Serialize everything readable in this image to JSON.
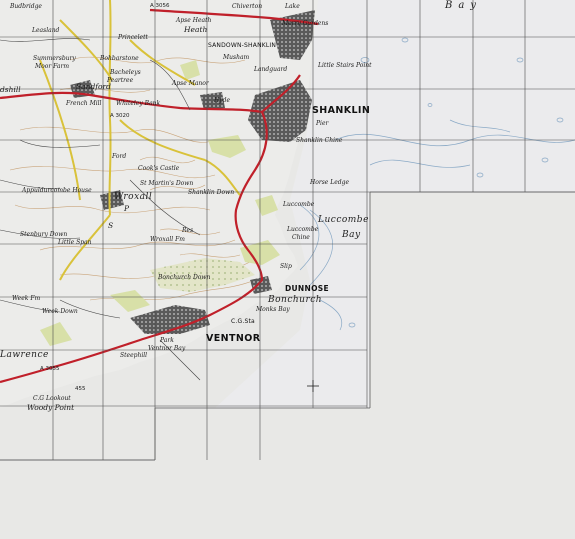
{
  "colors": {
    "background": "#e8e8e6",
    "land": "#ececea",
    "sea": "#e9eaec",
    "grid": "#4a4a4a",
    "main_road": "#c0202a",
    "secondary_road": "#d9c23a",
    "woodland": "#d8e0a8",
    "town": "#5a5a5a",
    "contour": "#c9a47a",
    "water_pattern": "#8aa9c6",
    "text": "#1a1a1a"
  },
  "labels": {
    "bay_top": "Bay",
    "shanklin": "SHANKLIN",
    "ventnor": "VENTNOR",
    "dunnose": "DUNNOSE",
    "bonchurch": "Bonchurch",
    "luccombe_bay_1": "Luccombe",
    "luccombe_bay_2": "Bay",
    "luccombe": "Luccombe",
    "luccombe_chine_1": "Luccombe",
    "luccombe_chine_2": "Chine",
    "horse_ledge": "Horse Ledge",
    "shanklin_chine": "Shanklin Chine",
    "little_stairs_point": "Little Stairs Point",
    "merry_gardens": "Merry Gardens",
    "sandown_shanklin": "SANDOWN-SHANKLIN",
    "landguard": "Landguard",
    "heath": "Heath",
    "wroxall": "Wroxall",
    "sandford": "Sandford",
    "godshill": "dshill",
    "whiteley_bank": "Whiteley Bank",
    "french_mill": "French Mill",
    "princelett": "Princelett",
    "budbridge": "Budbridge",
    "leasland": "Leasland",
    "summersbury": "Summersbury",
    "moor_farm": "Moor Farm",
    "bohbarstone": "Bohbarstone",
    "bacheleys": "Bacheleys",
    "peartree": "Peartree",
    "apse_manor": "Apse Manor",
    "apse_heath": "Apse Heath",
    "hyde": "Hyde",
    "chiverton": "Chiverton",
    "lake": "Lake",
    "musham": "Musham",
    "st_martins_down": "St Martin's Down",
    "shanklin_down": "Shanklin Down",
    "cooks_castle": "Cook's Castle",
    "wroxall_farm": "Wroxall Fm",
    "appuldurcombe": "Appuldurcombe House",
    "stenbury_down": "Stenbury Down",
    "little_span": "Little Span",
    "week_down": "Week Down",
    "week_farm": "Week Fm",
    "steephill": "Steephill",
    "ventnor_bay": "Ventnor Bay",
    "park": "Park",
    "monks_bay": "Monks Bay",
    "cg_sta": "C.G.Sta",
    "st_lawrence": "Lawrence",
    "cg_lookout": "C.G Lookout",
    "woody_point": "Woody Point",
    "bonchurch_down": "Bonchurch Down",
    "slip": "Slip",
    "road_a3056": "A 3056",
    "road_a3020": "A 3020",
    "road_a3055": "A 3055",
    "pier": "Pier",
    "res": "Res",
    "ford": "Ford",
    "p": "P",
    "s": "S",
    "num_455": "455"
  }
}
